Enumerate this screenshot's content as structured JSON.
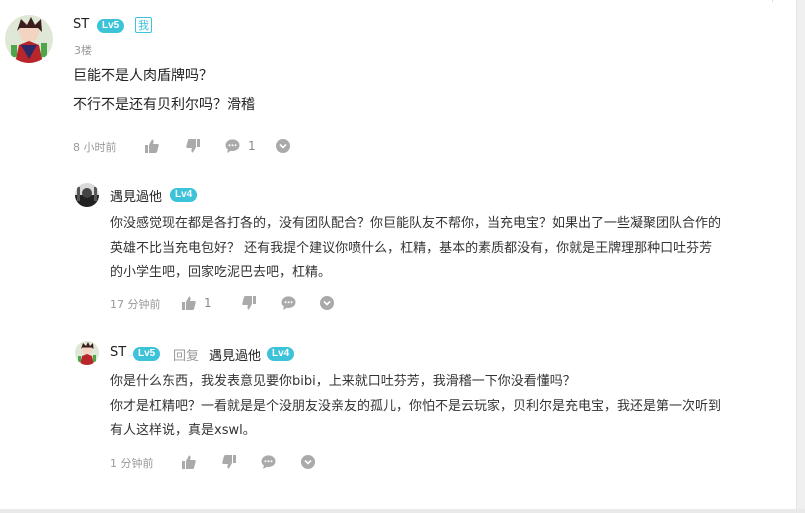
{
  "comment": {
    "author": "ST",
    "level": "Lv5",
    "me_tag": "我",
    "floor": "3楼",
    "lines": [
      "巨能不是人肉盾牌吗？",
      "不行不是还有贝利尔吗？滑稽"
    ],
    "time": "8 小时前",
    "comment_count": "1"
  },
  "replies": [
    {
      "author": "遇見過他",
      "level": "Lv4",
      "lines": [
        "你没感觉现在都是各打各的，没有团队配合？你巨能队友不帮你，当充电宝？如果出了一些凝聚团队合作的",
        "英雄不比当充电包好？ 还有我提个建议你喷什么，杠精，基本的素质都没有，你就是王牌理那种口吐芬芳",
        "的小学生吧，回家吃泥巴去吧，杠精。"
      ],
      "time": "17 分钟前",
      "like_count": "1"
    },
    {
      "author": "ST",
      "level": "Lv5",
      "reply_word": "回复",
      "reply_to": "遇見過他",
      "reply_to_level": "Lv4",
      "lines": [
        "你是什么东西，我发表意见要你bibi，上来就口吐芬芳，我滑稽一下你没看懂吗？",
        "你才是杠精吧？一看就是是个没朋友没亲友的孤儿，你怕不是云玩家，贝利尔是充电宝，我还是第一次听到",
        "有人这样说，真是xswl。"
      ],
      "time": "1 分钟前"
    }
  ],
  "colors": {
    "level_badge": "#3cc3d9",
    "muted": "#999999",
    "text": "#222222"
  },
  "icons": [
    "like-icon",
    "dislike-icon",
    "comment-icon",
    "more-icon"
  ]
}
